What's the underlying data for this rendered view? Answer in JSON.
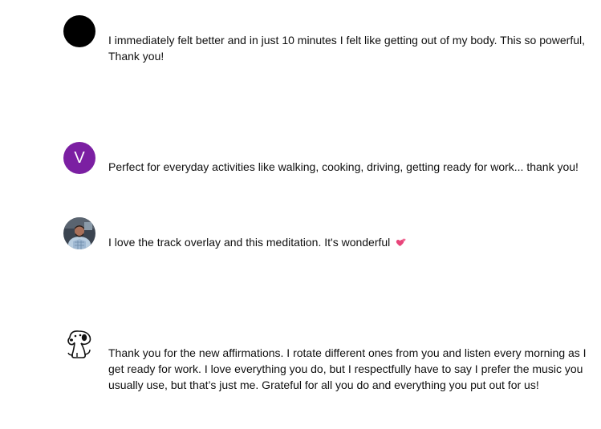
{
  "comments": [
    {
      "avatar_type": "black-circle",
      "text": "I immediately felt better and in just 10 minutes I felt like getting out of my body. This so powerful, Thank you!"
    },
    {
      "avatar_type": "letter",
      "avatar_letter": "V",
      "avatar_color": "#7b1fa2",
      "text": "Perfect for everyday activities like walking, cooking, driving, getting ready for work... thank you!"
    },
    {
      "avatar_type": "photo",
      "text": "I love the track overlay and this meditation. It's wonderful",
      "emoji": "two-hearts-icon"
    },
    {
      "avatar_type": "dog-drawing",
      "text": "Thank you for the new affirmations. I rotate different ones from you and listen every morning as I get ready for work. I love everything you do, but I respectfully have to say I prefer the music you usually use, but that’s just me. Grateful for all you do and everything you put out for us!"
    }
  ]
}
